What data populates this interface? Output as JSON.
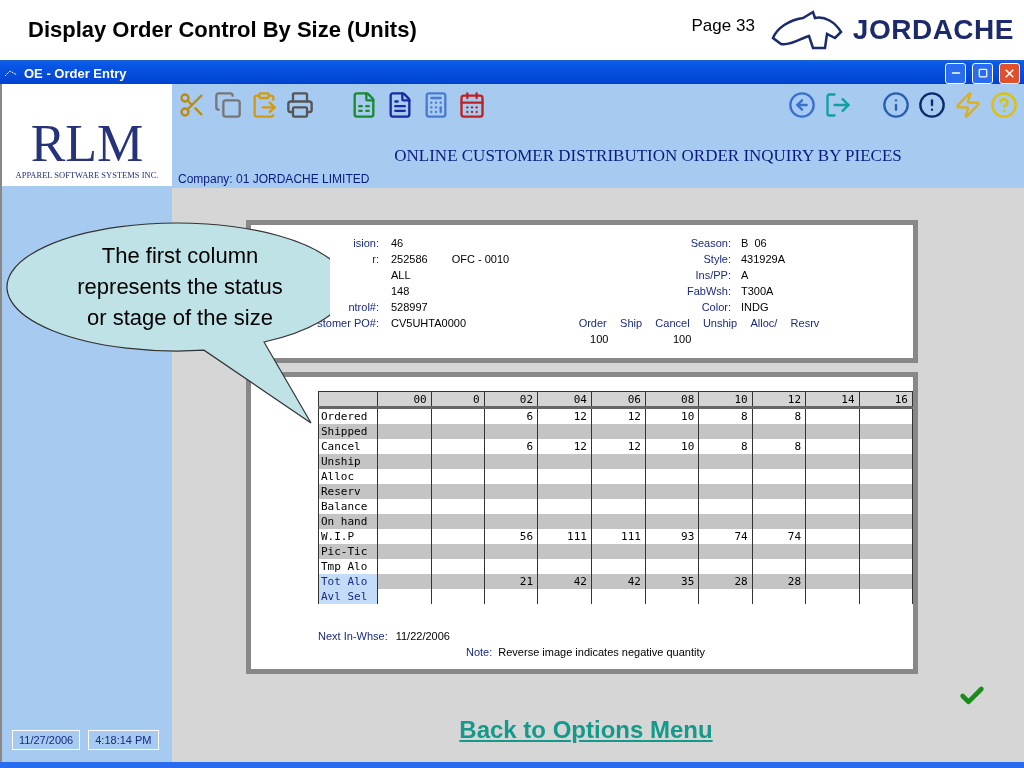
{
  "slide": {
    "title": "Display Order Control By Size (Units)",
    "page": "Page 33",
    "brand": "JORDACHE"
  },
  "window": {
    "title": "OE - Order Entry"
  },
  "logo": {
    "name": "RLM",
    "tagline": "APPAREL SOFTWARE SYSTEMS INC."
  },
  "heading": "ONLINE CUSTOMER DISTRIBUTION ORDER INQUIRY BY PIECES",
  "company": "Company:  01  JORDACHE LIMITED",
  "fields_left": [
    {
      "label": "ision:",
      "value": "46"
    },
    {
      "label": "r:",
      "value": "252586",
      "extra": "OFC - 0010"
    },
    {
      "value": "ALL"
    },
    {
      "value": "148"
    },
    {
      "label": "ntrol#:",
      "value": "528997"
    },
    {
      "label": "stomer PO#:",
      "value": "CV5UHTA0000"
    }
  ],
  "fields_right": [
    {
      "label": "Season:",
      "value": "B  06"
    },
    {
      "label": "Style:",
      "value": "431929A"
    },
    {
      "label": "Ins/PP:",
      "value": "A"
    },
    {
      "label": "FabWsh:",
      "value": "T300A"
    },
    {
      "label": "Color:",
      "value": "INDG"
    }
  ],
  "quantities": [
    {
      "label": "Order",
      "value": "100"
    },
    {
      "label": "Ship"
    },
    {
      "label": "Cancel",
      "value": "100"
    },
    {
      "label": "Unship"
    },
    {
      "label": "Alloc/"
    },
    {
      "label": "Resrv"
    }
  ],
  "grid": {
    "columns": [
      "00",
      "0",
      "02",
      "04",
      "06",
      "08",
      "10",
      "12",
      "14",
      "16"
    ],
    "rows": [
      {
        "label": "Ordered",
        "highlighted": false,
        "cells": [
          null,
          null,
          "6",
          "12",
          "12",
          "10",
          "8",
          "8",
          null,
          null
        ]
      },
      {
        "label": "Shipped",
        "highlighted": false,
        "cells": [
          null,
          null,
          null,
          null,
          null,
          null,
          null,
          null,
          null,
          null
        ]
      },
      {
        "label": "Cancel",
        "highlighted": false,
        "cells": [
          null,
          null,
          "6",
          "12",
          "12",
          "10",
          "8",
          "8",
          null,
          null
        ]
      },
      {
        "label": "Unship",
        "highlighted": false,
        "cells": [
          null,
          null,
          null,
          null,
          null,
          null,
          null,
          null,
          null,
          null
        ]
      },
      {
        "label": "Alloc",
        "highlighted": false,
        "cells": [
          null,
          null,
          null,
          null,
          null,
          null,
          null,
          null,
          null,
          null
        ]
      },
      {
        "label": "Reserv",
        "highlighted": false,
        "cells": [
          null,
          null,
          null,
          null,
          null,
          null,
          null,
          null,
          null,
          null
        ]
      },
      {
        "label": "Balance",
        "highlighted": false,
        "cells": [
          null,
          null,
          null,
          null,
          null,
          null,
          null,
          null,
          null,
          null
        ]
      },
      {
        "label": "On hand",
        "highlighted": false,
        "cells": [
          null,
          null,
          null,
          null,
          null,
          null,
          null,
          null,
          null,
          null
        ]
      },
      {
        "label": "W.I.P",
        "highlighted": false,
        "cells": [
          null,
          null,
          "56",
          "111",
          "111",
          "93",
          "74",
          "74",
          null,
          null
        ]
      },
      {
        "label": "Pic-Tic",
        "highlighted": false,
        "cells": [
          null,
          null,
          null,
          null,
          null,
          null,
          null,
          null,
          null,
          null
        ]
      },
      {
        "label": "Tmp Alo",
        "highlighted": false,
        "cells": [
          null,
          null,
          null,
          null,
          null,
          null,
          null,
          null,
          null,
          null
        ]
      },
      {
        "label": "Tot Alo",
        "highlighted": true,
        "cells": [
          null,
          null,
          "21",
          "42",
          "42",
          "35",
          "28",
          "28",
          null,
          null
        ]
      },
      {
        "label": "Avl Sel",
        "highlighted": true,
        "cells": [
          null,
          null,
          null,
          null,
          null,
          null,
          null,
          null,
          null,
          null
        ]
      }
    ]
  },
  "next_in_whse": {
    "label": "Next In-Whse:",
    "value": "11/22/2006"
  },
  "note": {
    "label": "Note:",
    "value": "Reverse image indicates negative quantity"
  },
  "status": {
    "date": "11/27/2006",
    "time": "4:18:14 PM"
  },
  "back_link": "Back to Options Menu",
  "callout": "The first column\nrepresents the status\nor stage of the size"
}
